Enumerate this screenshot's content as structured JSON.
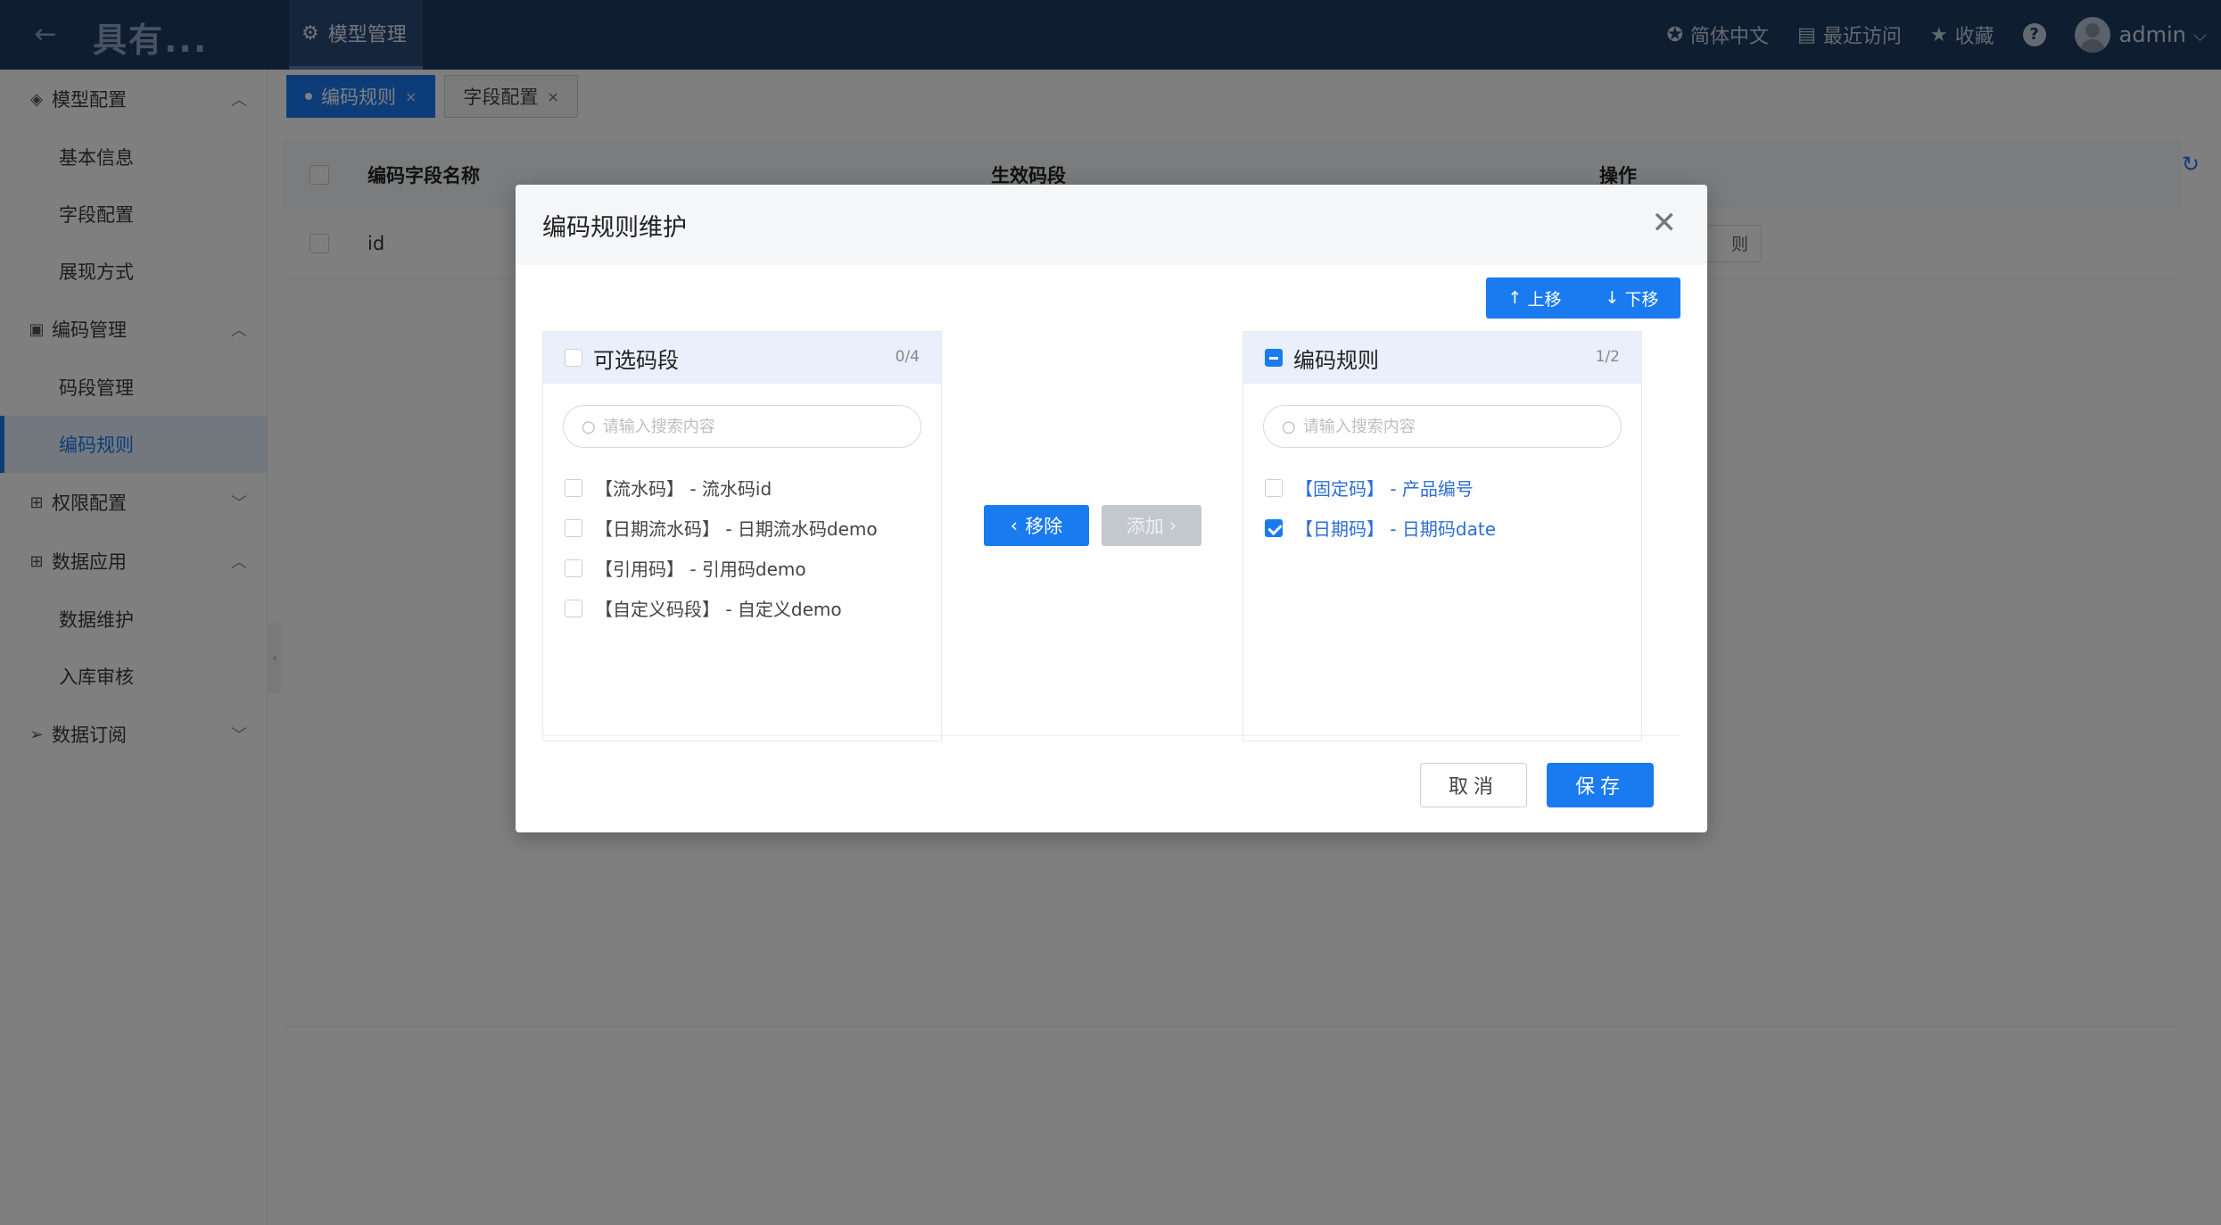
{
  "header": {
    "brand": "具有...",
    "active_tab": "模型管理",
    "language": "简体中文",
    "recent": "最近访问",
    "favorites": "收藏",
    "help": "?",
    "user": "admin"
  },
  "sidebar": {
    "groups": [
      {
        "label": "模型配置",
        "items": [
          "基本信息",
          "字段配置",
          "展现方式"
        ]
      },
      {
        "label": "编码管理",
        "items": [
          "码段管理",
          "编码规则"
        ]
      },
      {
        "label": "权限配置",
        "items": []
      },
      {
        "label": "数据应用",
        "items": [
          "数据维护",
          "入库审核"
        ]
      },
      {
        "label": "数据订阅",
        "items": []
      }
    ],
    "active_item": "编码规则"
  },
  "page_tabs": [
    {
      "label": "编码规则",
      "close": "×"
    },
    {
      "label": "字段配置",
      "close": "×"
    }
  ],
  "table": {
    "columns": [
      "编码字段名称",
      "生效码段",
      "操作"
    ],
    "rows": [
      {
        "name": "id",
        "action": "则"
      }
    ]
  },
  "modal": {
    "title": "编码规则维护",
    "move_up": "上移",
    "move_down": "下移",
    "left_panel": {
      "title": "可选码段",
      "count": "0/4",
      "search_placeholder": "请输入搜索内容",
      "items": [
        "【流水码】 - 流水码id",
        "【日期流水码】 - 日期流水码demo",
        "【引用码】 - 引用码demo",
        "【自定义码段】 - 自定义demo"
      ]
    },
    "right_panel": {
      "title": "编码规则",
      "count": "1/2",
      "search_placeholder": "请输入搜索内容",
      "items": [
        {
          "label": "【固定码】 - 产品编号",
          "checked": false
        },
        {
          "label": "【日期码】 - 日期码date",
          "checked": true
        }
      ]
    },
    "remove_label": "移除",
    "add_label": "添加",
    "cancel_label": "取消",
    "save_label": "保存"
  },
  "colors": {
    "header_bg": "#1f3a63",
    "primary": "#1a7af0",
    "overlay": "rgba(0,0,0,0.5)"
  }
}
